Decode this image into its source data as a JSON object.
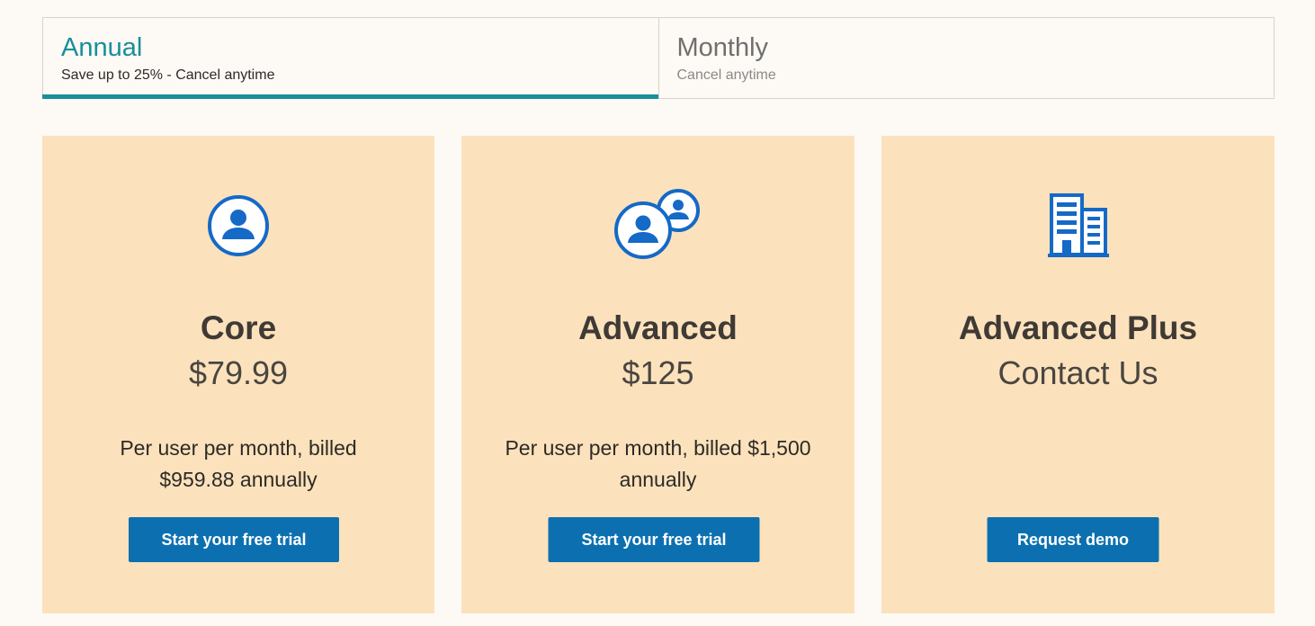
{
  "billing_toggle": {
    "annual": {
      "title": "Annual",
      "subtitle": "Save up to 25% - Cancel anytime"
    },
    "monthly": {
      "title": "Monthly",
      "subtitle": "Cancel anytime"
    },
    "selected": "annual"
  },
  "plans": [
    {
      "name": "Core",
      "price": "$79.99",
      "billing": "Per user per month, billed $959.88 annually",
      "cta": "Start your free trial",
      "icon": "single-user-icon"
    },
    {
      "name": "Advanced",
      "price": "$125",
      "billing": "Per user per month, billed $1,500 annually",
      "cta": "Start your free trial",
      "icon": "multiple-users-icon"
    },
    {
      "name": "Advanced Plus",
      "price": "Contact Us",
      "billing": "",
      "cta": "Request demo",
      "icon": "building-icon"
    }
  ],
  "colors": {
    "accent": "#16909a",
    "card_background": "#fbe2bc",
    "button": "#0c70b0",
    "icon": "#1569c7",
    "page_background": "#fdf9f4"
  }
}
